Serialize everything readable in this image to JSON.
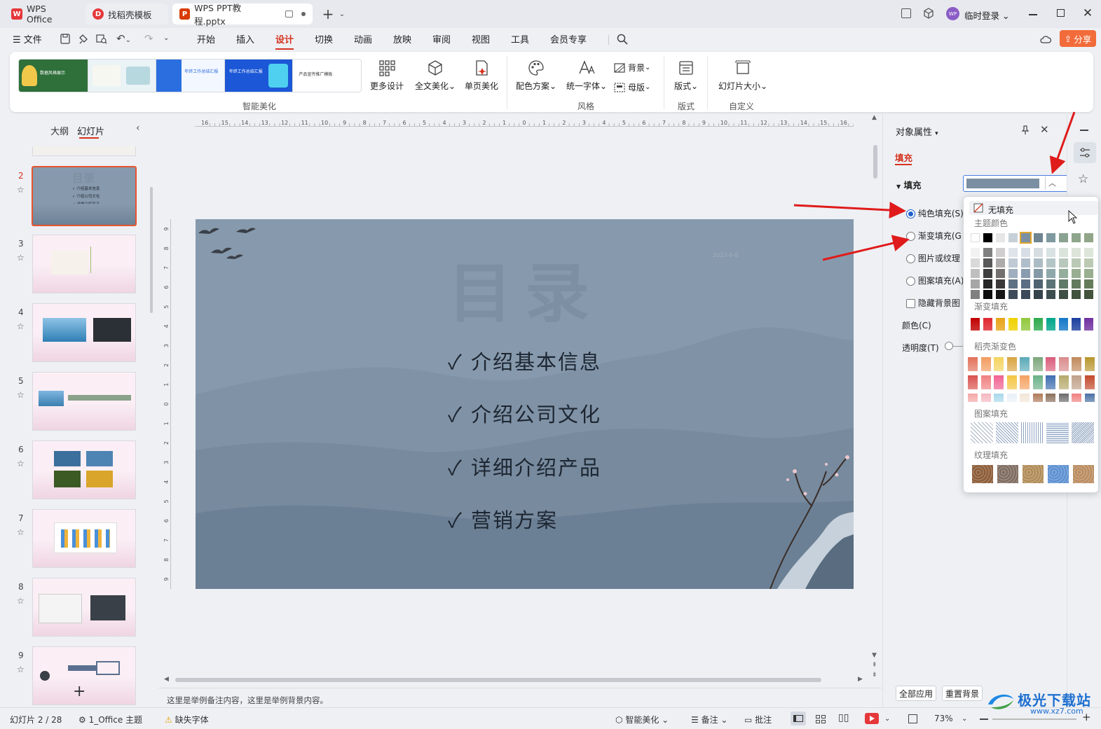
{
  "tabs": [
    {
      "label": "WPS Office",
      "logo": "W",
      "color": "#e5383b"
    },
    {
      "label": "找稻壳模板",
      "logo": "D",
      "color": "#e5383b"
    },
    {
      "label": "WPS PPT教程.pptx",
      "logo": "P",
      "color": "#d83b01"
    }
  ],
  "titlebar": {
    "login": "临时登录",
    "avatar": "WP"
  },
  "menu": {
    "file": "文件",
    "items": [
      "开始",
      "插入",
      "设计",
      "切换",
      "动画",
      "放映",
      "审阅",
      "视图",
      "工具",
      "会员专享"
    ],
    "active": "设计",
    "share": "分享"
  },
  "ribbon": {
    "templates": [
      "数据风格展示",
      "年终工作总结汇报",
      "工作总结汇报",
      "年终工作总结汇报",
      "产品宣传推广模板"
    ],
    "buttons": {
      "more_design": "更多设计",
      "full_beautify": "全文美化",
      "single_beautify": "单页美化",
      "color_scheme": "配色方案",
      "unify_font": "统一字体",
      "background": "背景",
      "master": "母版",
      "layout": "版式",
      "slide_size": "幻灯片大小"
    },
    "groups": {
      "smart": "智能美化",
      "style": "风格",
      "layout": "版式",
      "custom": "自定义"
    }
  },
  "leftpanel": {
    "tab_outline": "大纲",
    "tab_slides": "幻灯片",
    "slides": [
      "2",
      "3",
      "4",
      "5",
      "6",
      "7",
      "8",
      "9"
    ],
    "selected": "2",
    "thumb2_title": "目录"
  },
  "slide": {
    "title": "目录",
    "date": "2023-8-8",
    "bullets": [
      "介绍基本信息",
      "介绍公司文化",
      "详细介绍产品",
      "营销方案"
    ],
    "check": "✓",
    "bg_color": "#879aad"
  },
  "ruler_top": [
    "16",
    "15",
    "14",
    "13",
    "12",
    "11",
    "10",
    "9",
    "8",
    "7",
    "6",
    "5",
    "4",
    "3",
    "2",
    "1",
    "0",
    "1",
    "2",
    "3",
    "4",
    "5",
    "6",
    "7",
    "8",
    "9",
    "10",
    "11",
    "12",
    "13",
    "14",
    "15",
    "16"
  ],
  "ruler_left": [
    "9",
    "8",
    "7",
    "6",
    "5",
    "4",
    "3",
    "2",
    "1",
    "0",
    "1",
    "2",
    "3",
    "4",
    "5",
    "6",
    "7",
    "8",
    "9"
  ],
  "notes": "这里是举例备注内容，这里是举例背景内容。",
  "rightpanel": {
    "title": "对象属性",
    "tab_fill": "填充",
    "fill_label": "填充",
    "options": [
      "纯色填充(S)",
      "渐变填充(G",
      "图片或纹理",
      "图案填充(A)"
    ],
    "hide_bg": "隐藏背景图",
    "color_label": "颜色(C)",
    "transparency_label": "透明度(T)",
    "apply_all": "全部应用",
    "reset_bg": "重置背景",
    "current_color": "#7b8fa3"
  },
  "popup": {
    "no_fill": "无填充",
    "theme_colors": "主题颜色",
    "gradient_fill": "渐变填充",
    "docer_gradient": "稻壳渐变色",
    "pattern_fill": "图案填充",
    "texture_fill": "纹理填充"
  },
  "status": {
    "slide_info": "幻灯片 2 / 28",
    "theme": "1_Office 主题",
    "missing_font": "缺失字体",
    "smart_beautify": "智能美化",
    "notes": "备注",
    "comments": "批注",
    "zoom": "73%"
  },
  "watermark": {
    "name": "极光下载站",
    "url": "www.xz7.com"
  }
}
